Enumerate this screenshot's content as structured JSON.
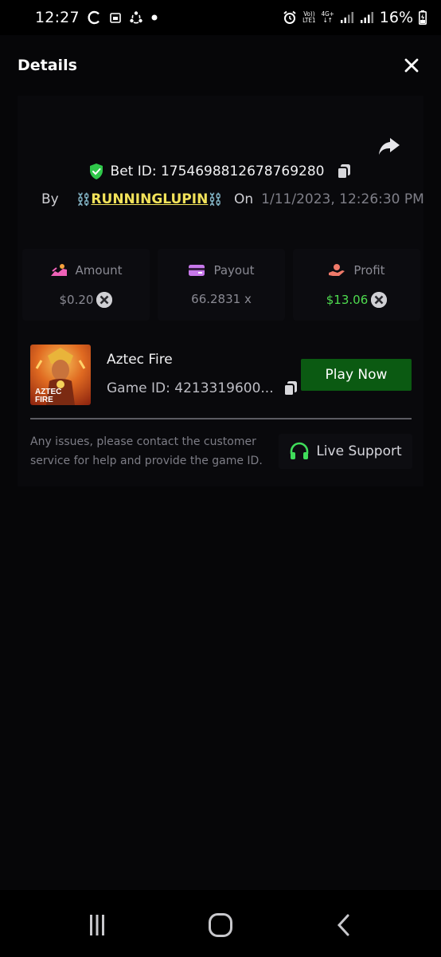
{
  "status_bar": {
    "time": "12:27",
    "battery": "16%",
    "volte": "Vo))",
    "lte": "LTE1",
    "net": "4G+"
  },
  "header": {
    "title": "Details"
  },
  "bet": {
    "id_label": "Bet ID: 1754698812678769280",
    "by_label": "By",
    "chain_left": "⛓️",
    "username": "RUNNINGLUPIN",
    "chain_right": "⛓️",
    "on_label": "On",
    "date": "1/11/2023, 12:26:30 PM"
  },
  "stats": {
    "amount_label": "Amount",
    "amount_value": "$0.20",
    "payout_label": "Payout",
    "payout_value": "66.2831 x",
    "profit_label": "Profit",
    "profit_value": "$13.06"
  },
  "game": {
    "name": "Aztec Fire",
    "id_text": "Game ID: 4213319600...",
    "thumb_text_line1": "AZTEC",
    "thumb_text_line2": "FIRE",
    "play_label": "Play Now"
  },
  "support": {
    "help_text": "Any issues, please contact the customer service for help and provide the game ID.",
    "live_support_label": "Live Support"
  },
  "colors": {
    "background": "#060608",
    "profit_green": "#4fdc4f",
    "play_button": "#0b5a12",
    "username_yellow": "#f2e25a",
    "shield_green": "#2fc84a"
  }
}
